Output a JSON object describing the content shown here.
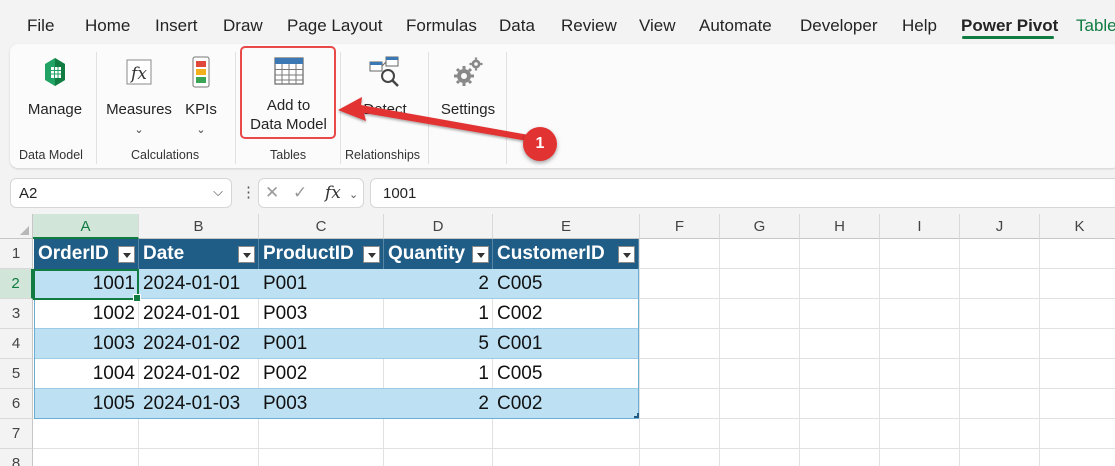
{
  "menu": {
    "tabs": [
      "File",
      "Home",
      "Insert",
      "Draw",
      "Page Layout",
      "Formulas",
      "Data",
      "Review",
      "View",
      "Automate",
      "Developer",
      "Help",
      "Power Pivot",
      "Table"
    ],
    "active": "Power Pivot"
  },
  "ribbon": {
    "manage_label": "Manage",
    "measures_label": "Measures",
    "kpis_label": "KPIs",
    "add_to_label_1": "Add to",
    "add_to_label_2": "Data Model",
    "detect_label": "Detect",
    "settings_label": "Settings",
    "groups": {
      "data_model": "Data Model",
      "calculations": "Calculations",
      "tables": "Tables",
      "relationships": "Relationships"
    },
    "annotation_number": "1",
    "highlight_color": "#e84a4a"
  },
  "formula_bar": {
    "name_box": "A2",
    "formula_value": "1001"
  },
  "sheet": {
    "columns": [
      "A",
      "B",
      "C",
      "D",
      "E",
      "F",
      "G",
      "H",
      "I",
      "J",
      "K"
    ],
    "rows": [
      "1",
      "2",
      "3",
      "4",
      "5",
      "6",
      "7",
      "8"
    ],
    "table": {
      "headers": [
        "OrderID",
        "Date",
        "ProductID",
        "Quantity",
        "CustomerID"
      ],
      "rows": [
        [
          "1001",
          "2024-01-01",
          "P001",
          "2",
          "C005"
        ],
        [
          "1002",
          "2024-01-01",
          "P003",
          "1",
          "C002"
        ],
        [
          "1003",
          "2024-01-02",
          "P001",
          "5",
          "C001"
        ],
        [
          "1004",
          "2024-01-02",
          "P002",
          "1",
          "C005"
        ],
        [
          "1005",
          "2024-01-03",
          "P003",
          "2",
          "C002"
        ]
      ],
      "header_color": "#1f5d86",
      "band_color": "#bde0f3"
    },
    "active_cell": "A2"
  },
  "colors": {
    "accent": "#107c41"
  }
}
